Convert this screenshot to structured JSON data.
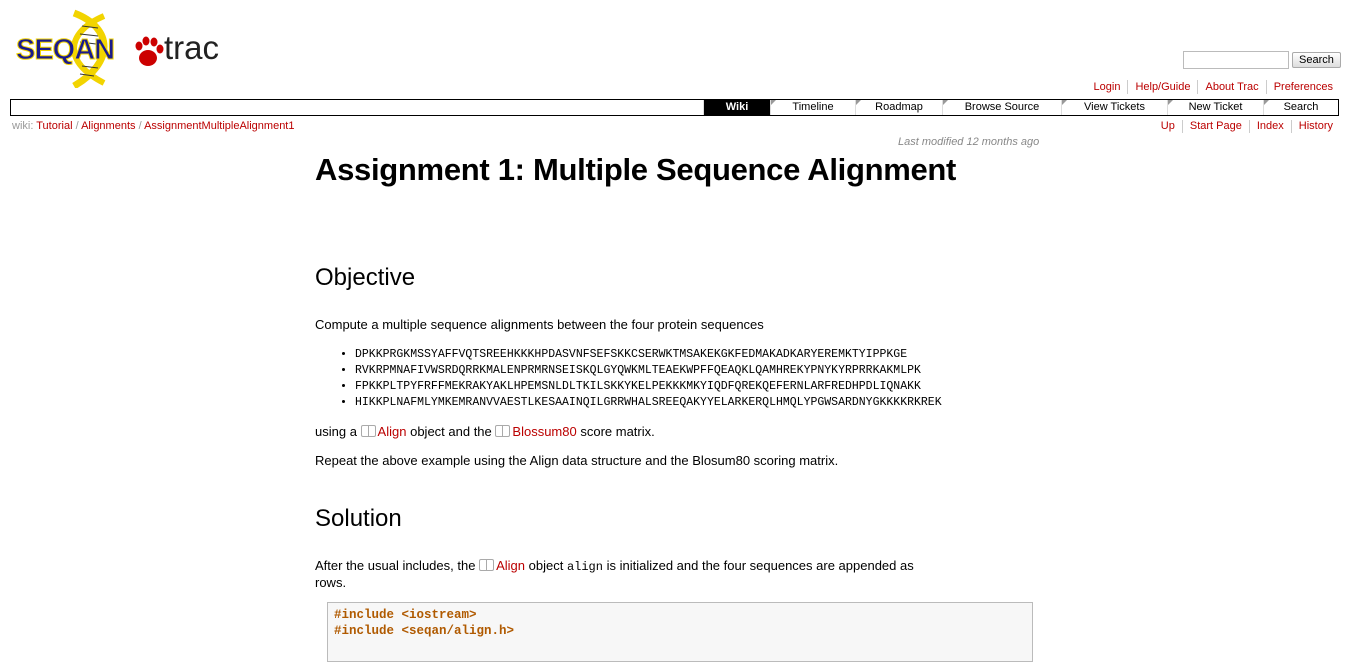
{
  "logo": {
    "primary": "SEQAN",
    "secondary": "trac"
  },
  "search": {
    "placeholder": "",
    "button": "Search"
  },
  "metanav": [
    "Login",
    "Help/Guide",
    "About Trac",
    "Preferences"
  ],
  "mainnav": [
    "Wiki",
    "Timeline",
    "Roadmap",
    "Browse Source",
    "View Tickets",
    "New Ticket",
    "Search"
  ],
  "mainnav_active": "Wiki",
  "breadcrumb": {
    "prefix": "wiki:",
    "items": [
      "Tutorial",
      "Alignments",
      "AssignmentMultipleAlignment1"
    ]
  },
  "ctxtnav": [
    "Up",
    "Start Page",
    "Index",
    "History"
  ],
  "last_modified": "Last modified 12 months ago",
  "page": {
    "title": "Assignment 1: Multiple Sequence Alignment",
    "objective_heading": "Objective",
    "objective_text": "Compute a multiple sequence alignments between the four protein sequences",
    "sequences": [
      "DPKKPRGKMSSYAFFVQTSREEHKKKHPDASVNFSEFSKKCSERWKTMSAKEKGKFEDMAKADKARYEREMKTYIPPKGE",
      "RVKRPMNAFIVWSRDQRRKMALENPRMRNSEISKQLGYQWKMLTEAEKWPFFQEAQKLQAMHREKYPNYKYRPRRKAKMLPK",
      "FPKKPLTPYFRFFMEKRAKYAKLHPEMSNLDLTKILSKKYKELPEKKKMKYIQDFQREKQEFERNLARFREDHPDLIQNAKK",
      "HIKKPLNAFMLYMKEMRANVVAESTLKESAAINQILGRRWHALSREEQAKYYELARKERQLHMQLYPGWSARDNYGKKKKRKREK"
    ],
    "using_a": "using a",
    "align_link": "Align",
    "object_and_the": "object and the",
    "blosum_link": "Blossum80",
    "score_matrix": "score matrix.",
    "repeat_text": "Repeat the above example using the Align data structure and the Blosum80 scoring matrix.",
    "solution_heading": "Solution",
    "after_usual": "After the usual includes, the",
    "align_link2": "Align",
    "object_word": "object",
    "align_var": "align",
    "rest_text": "is initialized and the four sequences are appended as",
    "rows_text": "rows.",
    "code_lines": [
      "#include <iostream>",
      "#include <seqan/align.h>"
    ]
  }
}
